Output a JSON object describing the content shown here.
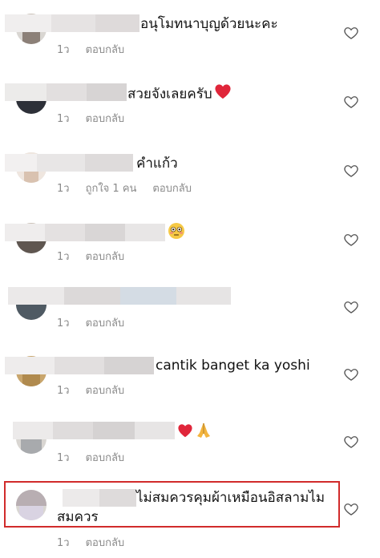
{
  "like_icon": "heart-outline-icon",
  "reply_label": "ตอบกลับ",
  "comments": [
    {
      "text": "อนุโมทนาบุญด้วยนะคะ",
      "time": "1ว",
      "likes": "",
      "reply": "ตอบกลับ",
      "emoji": ""
    },
    {
      "text": "สวยจังเลยครับ",
      "time": "1ว",
      "likes": "",
      "reply": "ตอบกลับ",
      "emoji": "red-heart"
    },
    {
      "text": "คำแก้ว",
      "time": "1ว",
      "likes": "ถูกใจ 1 คน",
      "reply": "ตอบกลับ",
      "emoji": ""
    },
    {
      "text": "",
      "time": "1ว",
      "likes": "",
      "reply": "ตอบกลับ",
      "emoji": "flushed-face"
    },
    {
      "text": "",
      "time": "1ว",
      "likes": "",
      "reply": "ตอบกลับ",
      "emoji": ""
    },
    {
      "text": "cantik banget ka yoshi",
      "time": "1ว",
      "likes": "",
      "reply": "ตอบกลับ",
      "emoji": ""
    },
    {
      "text": "",
      "time": "1ว",
      "likes": "",
      "reply": "ตอบกลับ",
      "emoji": "red-heart folded-hands"
    },
    {
      "text": "ไม่สมควรคุมผ้าเหมือนอิสลามไม",
      "text_line2": "สมควร",
      "time": "1ว",
      "likes": "",
      "reply": "ตอบกลับ",
      "emoji": ""
    }
  ],
  "colors": {
    "highlight": "#d12b2b",
    "meta": "#8a8a8a",
    "heart_emoji": "#e0263a"
  }
}
